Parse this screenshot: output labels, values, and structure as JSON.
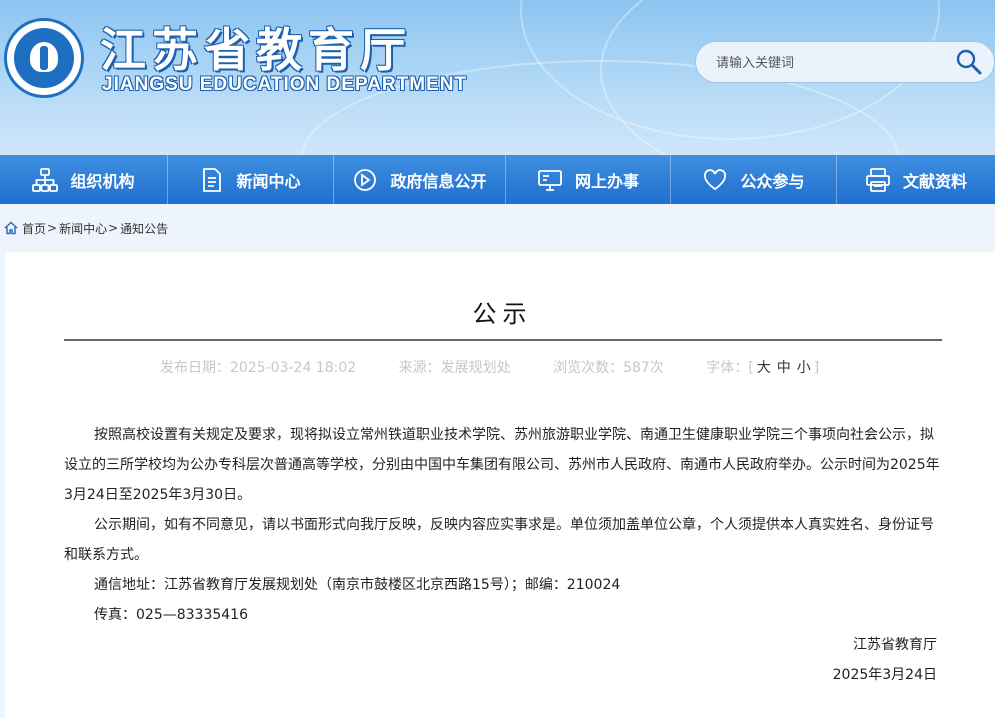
{
  "header": {
    "title": "江苏省教育厅",
    "subtitle": "JIANGSU EDUCATION DEPARTMENT",
    "search_placeholder": "请输入关键词"
  },
  "nav": [
    {
      "label": "组织机构",
      "icon": "org-chart-icon"
    },
    {
      "label": "新闻中心",
      "icon": "document-icon"
    },
    {
      "label": "政府信息公开",
      "icon": "play-circle-icon"
    },
    {
      "label": "网上办事",
      "icon": "monitor-icon"
    },
    {
      "label": "公众参与",
      "icon": "heart-icon"
    },
    {
      "label": "文献资料",
      "icon": "printer-icon"
    }
  ],
  "breadcrumb": {
    "home": "首页",
    "news": "新闻中心",
    "current": "通知公告",
    "sep": ">"
  },
  "article": {
    "title": "公示",
    "publish_label": "发布日期：",
    "publish_date": "2025-03-24 18:02",
    "source_label": "来源：",
    "source": "发展规划处",
    "views_label": "浏览次数：",
    "views": "587次",
    "font_label": "字体：",
    "font_large": "大",
    "font_medium": "中",
    "font_small": "小",
    "paragraphs": [
      "按照高校设置有关规定及要求，现将拟设立常州铁道职业技术学院、苏州旅游职业学院、南通卫生健康职业学院三个事项向社会公示，拟设立的三所学校均为公办专科层次普通高等学校，分别由中国中车集团有限公司、苏州市人民政府、南通市人民政府举办。公示时间为2025年3月24日至2025年3月30日。",
      "公示期间，如有不同意见，请以书面形式向我厅反映，反映内容应实事求是。单位须加盖单位公章，个人须提供本人真实姓名、身份证号和联系方式。",
      "通信地址：江苏省教育厅发展规划处（南京市鼓楼区北京西路15号）；邮编：210024",
      "传真：025—83335416"
    ],
    "signature": "江苏省教育厅",
    "sign_date": "2025年3月24日"
  },
  "colors": {
    "nav_bg": "#1f6fcf",
    "header_bg": "#8cc4f0",
    "page_bg": "#eef4fb"
  }
}
